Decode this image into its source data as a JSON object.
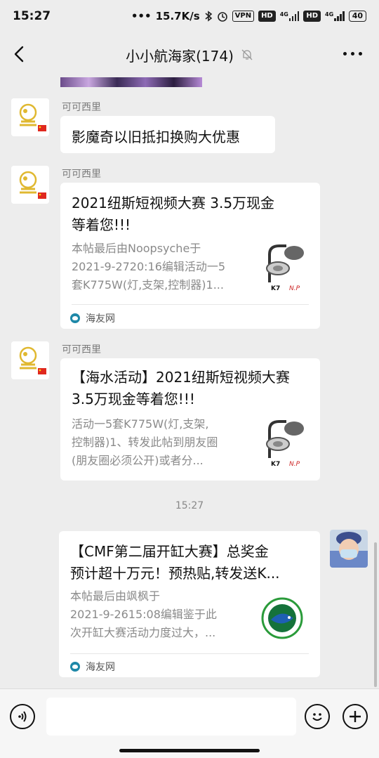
{
  "status": {
    "time": "15:27",
    "network_speed": "15.7K/s",
    "vpn_label": "VPN",
    "hd1": "HD",
    "net1": "4G",
    "hd2": "HD",
    "net2": "4G",
    "battery": "40"
  },
  "header": {
    "title": "小小航海家(174)"
  },
  "messages": [
    {
      "sender": "可可西里",
      "type": "text",
      "text": "影魔奇以旧抵扣换购大优惠"
    },
    {
      "sender": "可可西里",
      "type": "card",
      "title_line1": "2021纽斯短视频大赛 3.5万现金",
      "title_line2": "等着您!!!",
      "desc_line1": "本帖最后由Noopsyche于",
      "desc_line2": "2021-9-2720:16编辑活动一5",
      "desc_line3": "套K775W(灯,支架,控制器)1...",
      "source": "海友网"
    },
    {
      "sender": "可可西里",
      "type": "card",
      "title_line1": "【海水活动】2021纽斯短视频大赛",
      "title_line2": "3.5万现金等着您!!!",
      "desc_line1": "活动一5套K775W(灯,支架,",
      "desc_line2": "控制器)1、转发此帖到朋友圈",
      "desc_line3": "(朋友圈必须公开)或者分..."
    },
    {
      "type": "timestamp",
      "text": "15:27"
    },
    {
      "type": "card-self",
      "title_line1": "【CMF第二届开缸大赛】总奖金",
      "title_line2": "预计超十万元！预热贴,转发送K...",
      "desc_line1": "本帖最后由飒枫于",
      "desc_line2": "2021-9-2615:08编辑鉴于此",
      "desc_line3": "次开缸大赛活动力度过大，...",
      "source": "海友网"
    }
  ],
  "thumb_text": {
    "k7": "K7",
    "np": "N.P"
  },
  "input": {
    "value": ""
  },
  "colors": {
    "background": "#ededed",
    "bubble": "#ffffff",
    "source_icon": "#1e88a8"
  },
  "icons": [
    "back-arrow-icon",
    "mute-bell-icon",
    "more-icon",
    "voice-icon",
    "emoji-icon",
    "plus-icon"
  ]
}
